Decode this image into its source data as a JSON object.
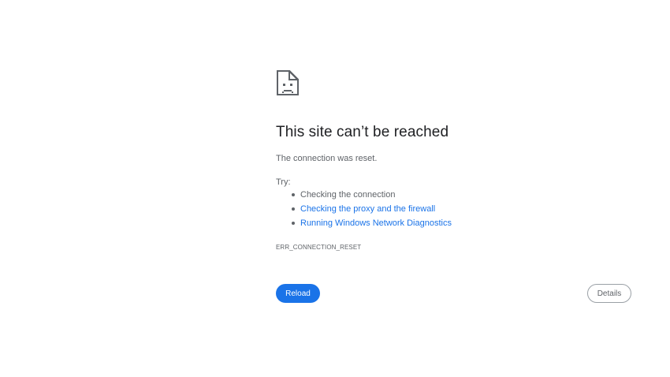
{
  "error_page": {
    "icon": "sad-page-icon",
    "title": "This site can’t be reached",
    "message": "The connection was reset.",
    "try_label": "Try:",
    "suggestions": [
      {
        "text": "Checking the connection",
        "is_link": false
      },
      {
        "text": "Checking the proxy and the firewall",
        "is_link": true
      },
      {
        "text": "Running Windows Network Diagnostics",
        "is_link": true
      }
    ],
    "error_code": "ERR_CONNECTION_RESET",
    "reload_label": "Reload",
    "details_label": "Details"
  },
  "colors": {
    "accent": "#1a73e8",
    "text_primary": "#202124",
    "text_secondary": "#5f6368",
    "background": "#ffffff"
  }
}
